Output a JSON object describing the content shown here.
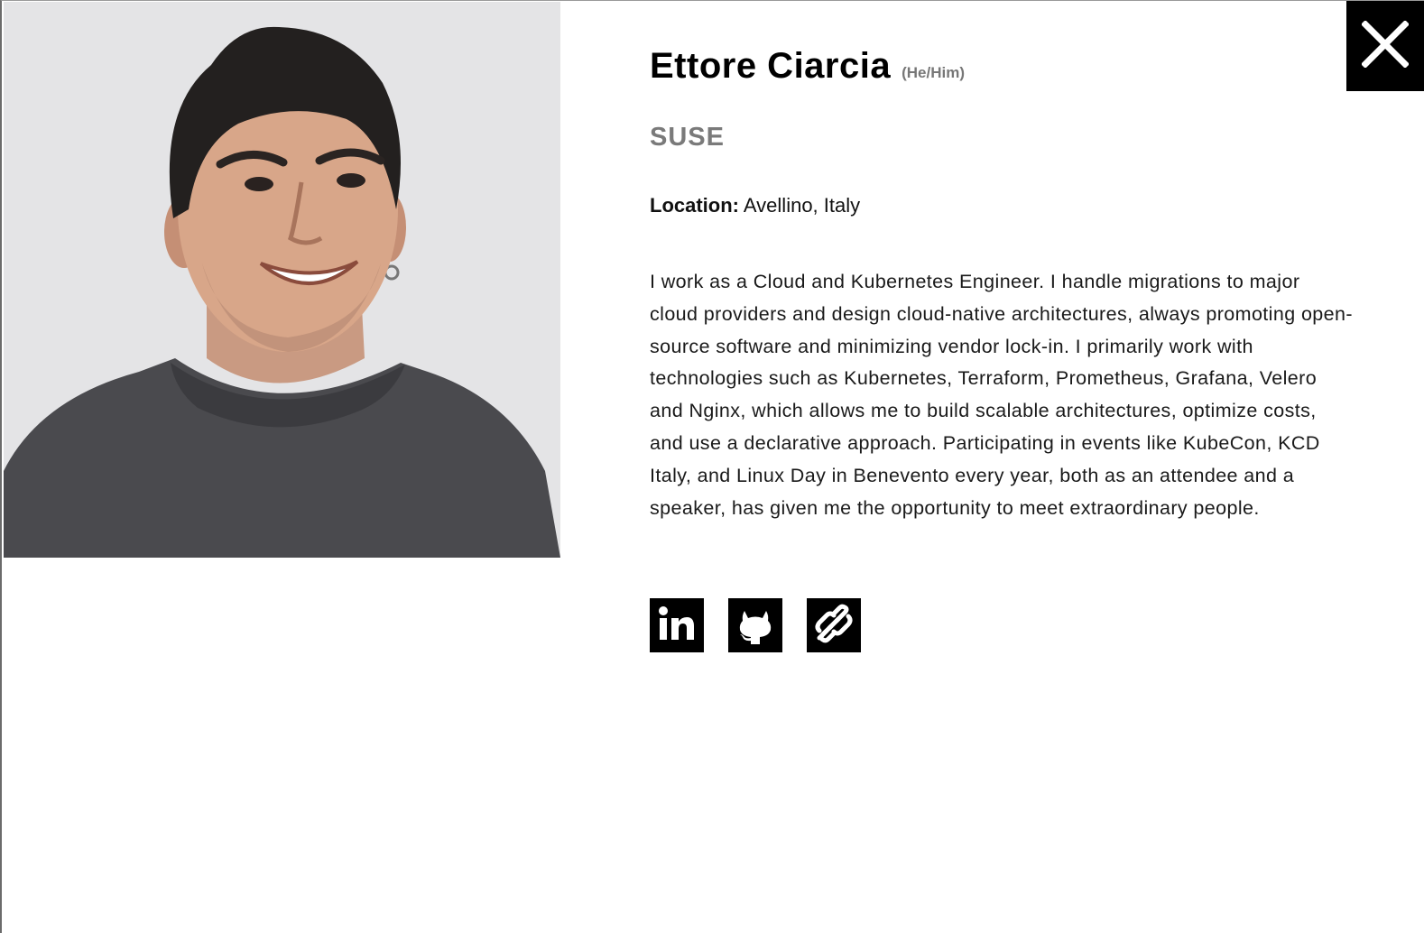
{
  "speaker": {
    "name": "Ettore Ciarcia",
    "pronouns": "(He/Him)",
    "company": "SUSE",
    "location_label": "Location:",
    "location_value": "Avellino, Italy",
    "bio": "I work as a Cloud and Kubernetes Engineer. I handle migrations to major cloud providers and design cloud-native architectures, always promoting open-source software and minimizing vendor lock-in. I primarily work with technologies such as Kubernetes, Terraform, Prometheus, Grafana, Velero and Nginx, which allows me to build scalable architectures, optimize costs, and use a declarative approach. Participating in events like KubeCon, KCD Italy, and Linux Day in Benevento every year, both as an attendee and a speaker, has given me the opportunity to meet extraordinary people."
  },
  "socials": [
    {
      "icon": "linkedin-icon"
    },
    {
      "icon": "github-icon"
    },
    {
      "icon": "link-icon"
    }
  ],
  "controls": {
    "close_icon": "close-icon"
  },
  "colors": {
    "accent": "#000000",
    "company": "#7a7a7a",
    "pronouns": "#777777",
    "photo_background": "#e5e5e6"
  }
}
